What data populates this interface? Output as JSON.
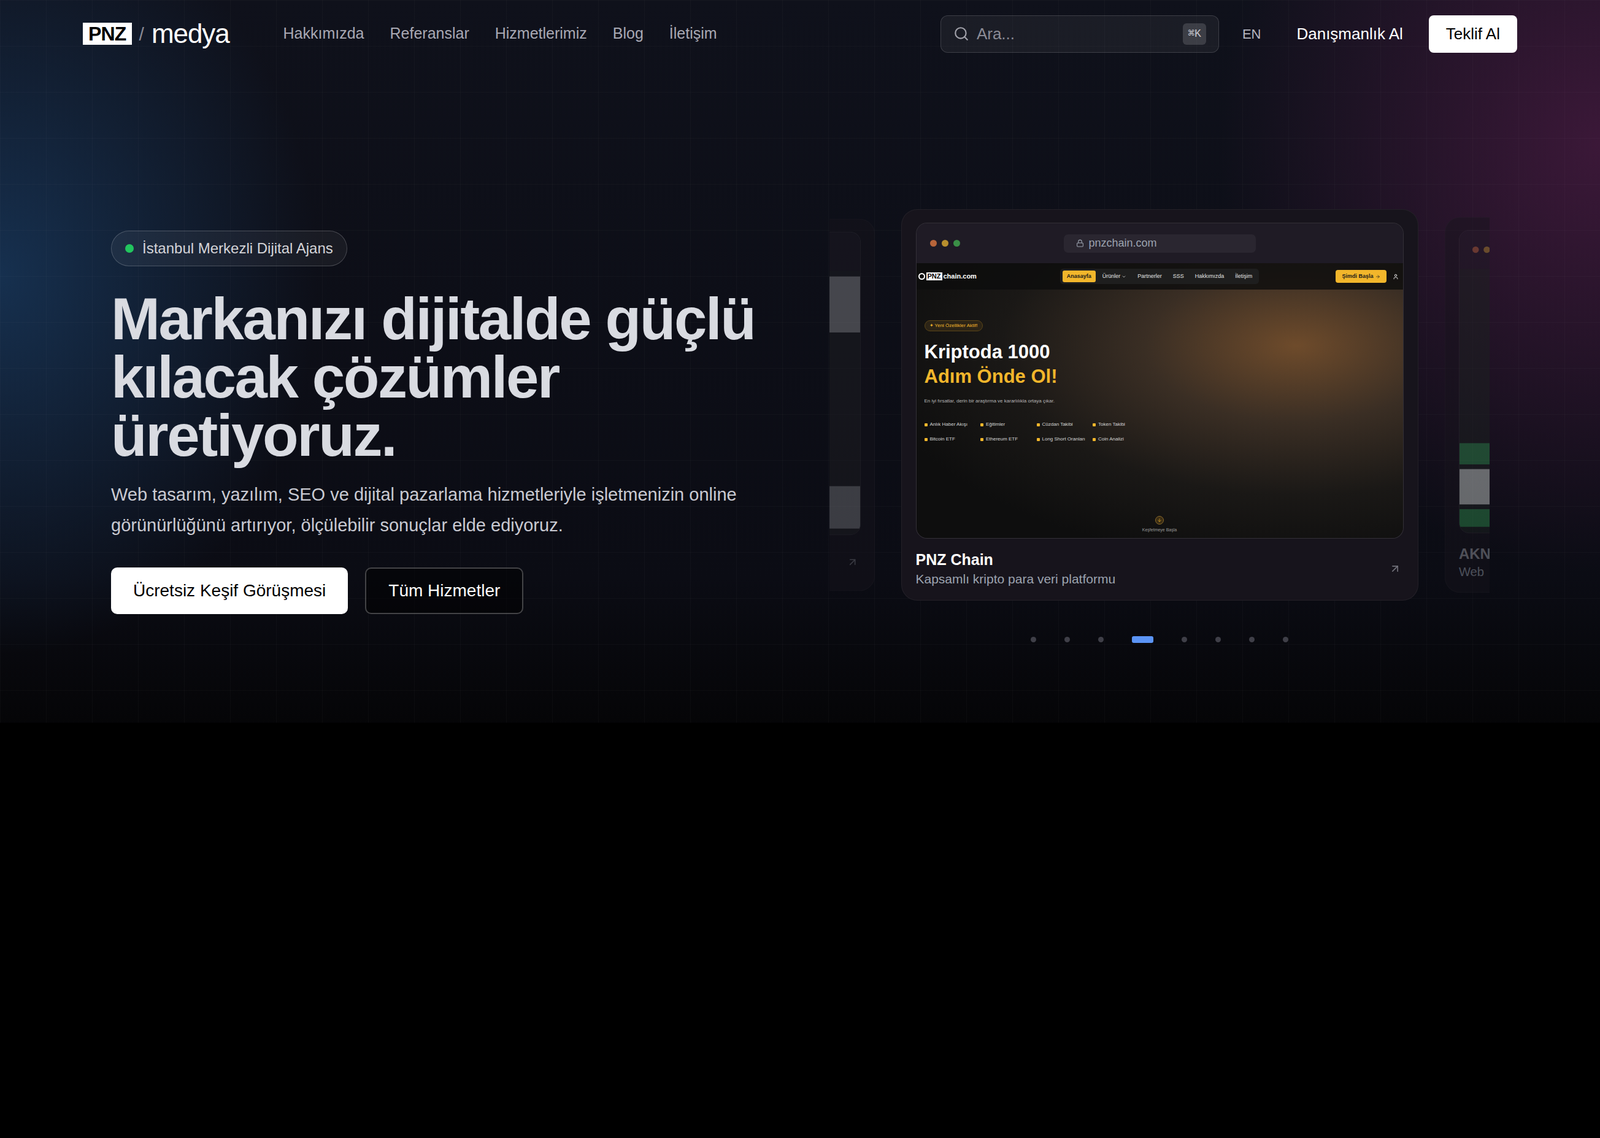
{
  "header": {
    "logo": {
      "mark": "PNZ",
      "separator": "/",
      "name": "medya"
    },
    "nav": [
      "Hakkımızda",
      "Referanslar",
      "Hizmetlerimiz",
      "Blog",
      "İletişim"
    ],
    "search": {
      "placeholder": "Ara...",
      "shortcut": "⌘K"
    },
    "language": "EN",
    "consult": "Danışmanlık Al",
    "cta": "Teklif Al"
  },
  "hero": {
    "badge": "İstanbul Merkezli Dijital Ajans",
    "headline": [
      "Markanızı dijitalde güçlü",
      "kılacak çözümler",
      "üretiyoruz."
    ],
    "description": "Web tasarım, yazılım, SEO ve dijital pazarlama hizmetleriyle işletmenizin online görünürlüğünü artırıyor, ölçülebilir sonuçlar elde ediyoruz.",
    "buttons": [
      {
        "label": "Ücretsiz Keşif Görüşmesi",
        "kind": "primary"
      },
      {
        "label": "Tüm Hizmetler",
        "kind": "secondary"
      }
    ]
  },
  "carousel": {
    "slides": [
      {
        "kind": "partial-left",
        "selected": false
      },
      {
        "kind": "browser",
        "selected": true,
        "url": "pnzchain.com",
        "title": "PNZ Chain",
        "subtitle": "Kapsamlı kripto para veri platformu",
        "site": {
          "logo": {
            "mark": "PNZ",
            "name": "chain.com"
          },
          "nav": [
            {
              "label": "Anasayfa",
              "selected": true,
              "dropdown": false
            },
            {
              "label": "Ürünler",
              "selected": false,
              "dropdown": true
            },
            {
              "label": "Partnerler",
              "selected": false,
              "dropdown": false
            },
            {
              "label": "SSS",
              "selected": false,
              "dropdown": false
            },
            {
              "label": "Hakkımızda",
              "selected": false,
              "dropdown": false
            },
            {
              "label": "İletişim",
              "selected": false,
              "dropdown": false
            }
          ],
          "cta": "Şimdi Başla",
          "badge": "✦ Yeni Özellikler Aktif!",
          "headline": "Kriptoda 1000",
          "headline_accent": "Adım Önde Ol!",
          "lead": "En iyi fırsatlar, derin bir araştırma ve kararlılıkla ortaya çıkar.",
          "features": [
            "Anlık Haber Akışı",
            "Eğitimler",
            "Cüzdan Takibi",
            "Token Takibi",
            "Bitcoin ETF",
            "Ethereum ETF",
            "Long Short Oranları",
            "Coin Analizi"
          ],
          "scroll": "Keşfetmeye Başla"
        }
      },
      {
        "kind": "partial-right",
        "selected": false,
        "title": "AKN",
        "subtitle": "Web"
      }
    ],
    "dots": [
      {
        "selected": false
      },
      {
        "selected": false
      },
      {
        "selected": false
      },
      {
        "selected": true
      },
      {
        "selected": false
      },
      {
        "selected": false
      },
      {
        "selected": false
      },
      {
        "selected": false
      }
    ]
  }
}
